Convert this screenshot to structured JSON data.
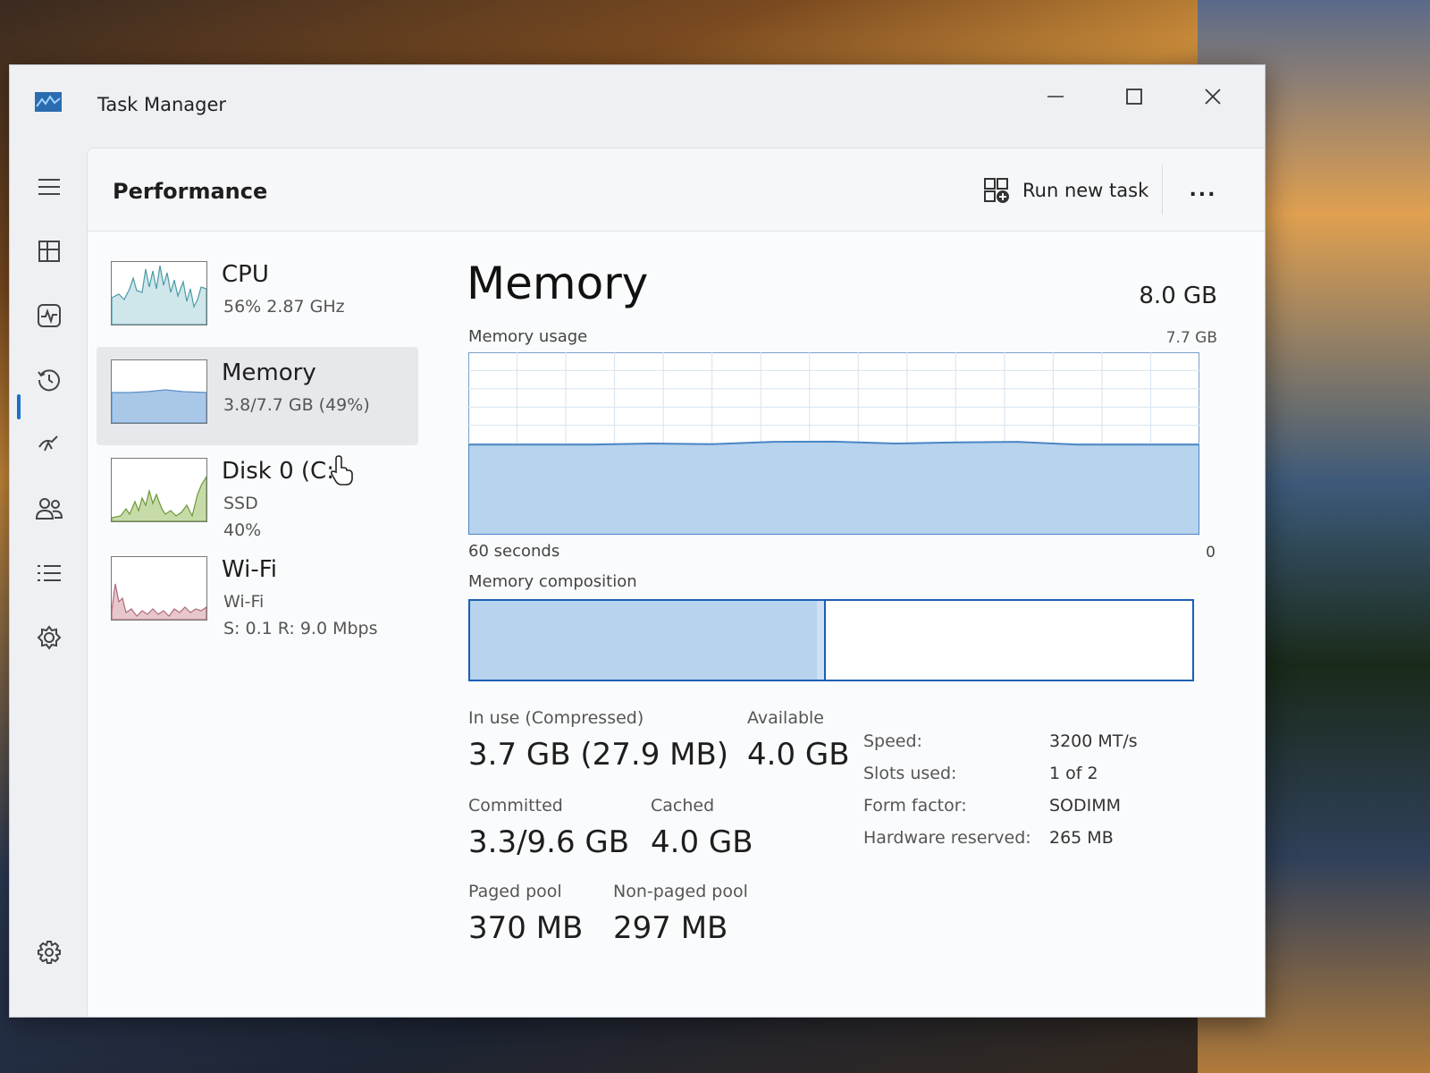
{
  "window": {
    "title": "Task Manager"
  },
  "header": {
    "title": "Performance",
    "run_new_task": "Run new task",
    "more": "..."
  },
  "nav": {
    "items": [
      {
        "id": "menu",
        "icon": "hamburger-icon"
      },
      {
        "id": "processes",
        "icon": "processes-icon"
      },
      {
        "id": "performance",
        "icon": "performance-icon",
        "active": true
      },
      {
        "id": "app-history",
        "icon": "history-icon"
      },
      {
        "id": "startup",
        "icon": "startup-icon"
      },
      {
        "id": "users",
        "icon": "users-icon"
      },
      {
        "id": "details",
        "icon": "details-list-icon"
      },
      {
        "id": "services",
        "icon": "services-icon"
      },
      {
        "id": "settings",
        "icon": "gear-icon"
      }
    ]
  },
  "devices": [
    {
      "name": "CPU",
      "sub1": "56%  2.87 GHz",
      "sub2": "",
      "color": "#4a9aa8"
    },
    {
      "name": "Memory",
      "sub1": "3.8/7.7 GB (49%)",
      "sub2": "",
      "color": "#5b8fc9",
      "selected": true
    },
    {
      "name": "Disk 0 (C:)",
      "sub1": "SSD",
      "sub2": "40%",
      "color": "#6a9a3a"
    },
    {
      "name": "Wi-Fi",
      "sub1": "Wi-Fi",
      "sub2": "S: 0.1  R: 9.0 Mbps",
      "color": "#b06a7a"
    }
  ],
  "detail": {
    "title": "Memory",
    "total": "8.0 GB",
    "usage_label": "Memory usage",
    "usage_max": "7.7 GB",
    "axis_left": "60 seconds",
    "axis_right": "0",
    "composition_label": "Memory composition",
    "composition": {
      "in_use_fraction": 0.48,
      "modified_fraction": 0.01
    },
    "stats": {
      "in_use_label": "In use (Compressed)",
      "in_use_value": "3.7 GB (27.9 MB)",
      "available_label": "Available",
      "available_value": "4.0 GB",
      "committed_label": "Committed",
      "committed_value": "3.3/9.6 GB",
      "cached_label": "Cached",
      "cached_value": "4.0 GB",
      "paged_label": "Paged pool",
      "paged_value": "370 MB",
      "nonpaged_label": "Non-paged pool",
      "nonpaged_value": "297 MB"
    },
    "properties": [
      {
        "key": "Speed:",
        "value": "3200 MT/s"
      },
      {
        "key": "Slots used:",
        "value": "1 of 2"
      },
      {
        "key": "Form factor:",
        "value": "SODIMM"
      },
      {
        "key": "Hardware reserved:",
        "value": "265 MB"
      }
    ],
    "accent": "#1a5fb4",
    "fill": "#b7d3ee"
  },
  "chart_data": {
    "type": "area",
    "x": [
      60,
      55,
      50,
      45,
      40,
      35,
      30,
      25,
      20,
      15,
      10,
      5,
      0
    ],
    "values": [
      3.8,
      3.8,
      3.8,
      3.85,
      3.82,
      3.92,
      3.93,
      3.85,
      3.9,
      3.92,
      3.8,
      3.8,
      3.8
    ],
    "xlabel": "60 seconds",
    "ylim": [
      0,
      7.7
    ],
    "grid": true
  }
}
